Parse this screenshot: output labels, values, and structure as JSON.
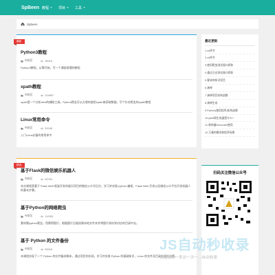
{
  "navbar": {
    "brand": "SpBeen",
    "items": [
      {
        "label": "教程"
      },
      {
        "label": "项目"
      },
      {
        "label": "工具"
      }
    ],
    "color": "#1aae9f"
  },
  "breadcrumb": {
    "home": "Spbeen"
  },
  "latest": {
    "badge": "最新",
    "articles": [
      {
        "title": "Python3教程",
        "category": "布前区",
        "views": "38416",
        "desc": "Python3教程，从零开始，写一个通俗易懂的教程"
      },
      {
        "title": "xpath教程",
        "category": "布前区",
        "views": "204897",
        "desc": "xpath是一个分析html的辅助工具。Python爬虫可以方便的使用xpath来获取数据，写个针对爬虫的xpath教程"
      },
      {
        "title": "Linux常用命令",
        "category": "布前区",
        "views": "51048",
        "desc": "入门Linux必备的常用命令"
      }
    ]
  },
  "recommend": {
    "badge": "精选",
    "articles": [
      {
        "title": "基于Flask的微信娱乐机器人",
        "category": "布前区",
        "views": "69764",
        "desc": "本次课程是基于 Flask Web 框架开发的娱乐项目的微信公众号后台，学习并实践 python 编程、Flask Web 开发以及微信公众平台开发机器人的基本步骤。"
      },
      {
        "title": "基于Python的网络爬虫",
        "category": "布前区",
        "views": "110061",
        "desc": "素材爬python爬虫，用爬得图片。根据图片后缀创建本地文件夹并将图片保存到对应的目录中去。"
      },
      {
        "title": "基于 Python 的文件备份",
        "category": "布前区",
        "views": "55418",
        "desc": "本课程实现了一个 Python 的文件备份脚本，通过项目的实现，学习并实践 Python 的基础知识，Linux 的文件及目录处理方法等。"
      }
    ]
  },
  "sidebar": {
    "title": "最近更新",
    "items": [
      "1.cd命令",
      "2.cd命令",
      "3.使用爬虫测试接口抓取",
      "4.通过日志测试接口抓取",
      "5.客体的知识项目",
      "6.演绎",
      "7.演绎项目机构函数",
      "8.演绎生成",
      "9.Python(使用程序)机构函数",
      "10.yield和生成器是什么?",
      "11.装饰器Decorator使用",
      "12.万事的模块和程序场景"
    ]
  },
  "qr": {
    "title": "扫码关注微信公众号"
  },
  "watermark": {
    "logo": "JS自动秒收录",
    "sub": "快速收录一来访一次一→自动收录"
  }
}
